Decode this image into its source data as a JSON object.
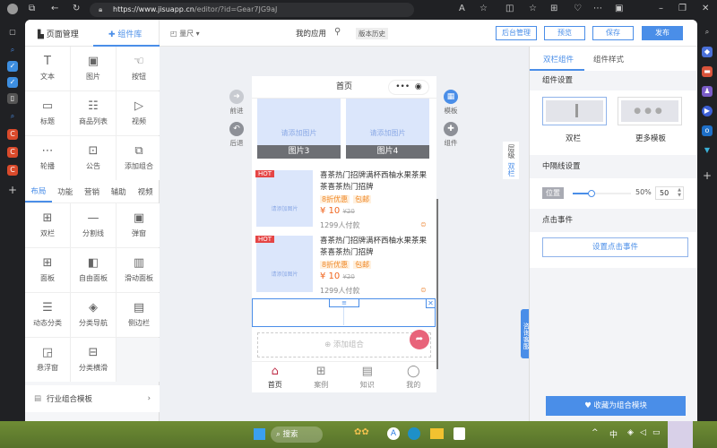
{
  "browser": {
    "url_host": "https://www.jisuapp.cn",
    "url_path": "/editor/?id=Gear7JG9aJ"
  },
  "header": {
    "tab_pages": "页面管理",
    "tab_components": "组件库",
    "ruler": "量尺",
    "app_name": "我的应用",
    "version_history": "版本历史",
    "btn_admin": "后台管理",
    "btn_preview": "预览",
    "btn_save": "保存",
    "btn_publish": "发布"
  },
  "left_panel": {
    "basic": [
      {
        "label": "文本",
        "icon": "T"
      },
      {
        "label": "图片",
        "icon": "▣"
      },
      {
        "label": "按钮",
        "icon": "☜"
      },
      {
        "label": "标题",
        "icon": "▭"
      },
      {
        "label": "商品列表",
        "icon": "☷"
      },
      {
        "label": "视频",
        "icon": "▷"
      },
      {
        "label": "轮播",
        "icon": "⋯"
      },
      {
        "label": "公告",
        "icon": "⊡"
      },
      {
        "label": "添加组合",
        "icon": "⧉"
      }
    ],
    "tabs": [
      "布局",
      "功能",
      "营销",
      "辅助",
      "视频"
    ],
    "layout": [
      {
        "label": "双栏",
        "icon": "⊞"
      },
      {
        "label": "分割线",
        "icon": "—"
      },
      {
        "label": "弹窗",
        "icon": "▣"
      },
      {
        "label": "面板",
        "icon": "⊞"
      },
      {
        "label": "自由面板",
        "icon": "◧"
      },
      {
        "label": "滑动面板",
        "icon": "▥"
      },
      {
        "label": "动态分类",
        "icon": "☰"
      },
      {
        "label": "分类导航",
        "icon": "◈"
      },
      {
        "label": "侧边栏",
        "icon": "▤"
      },
      {
        "label": "悬浮窗",
        "icon": "◲"
      },
      {
        "label": "分类横滑",
        "icon": "⊟"
      }
    ],
    "industry_templates": "行业组合模板"
  },
  "canvas": {
    "forward": "前进",
    "back": "后退",
    "template": "模板",
    "component": "组件",
    "layer": "层级",
    "double": "双栏",
    "consult": "咨询客服"
  },
  "phone": {
    "title": "首页",
    "images": [
      {
        "placeholder": "请添加图片",
        "caption": "图片3"
      },
      {
        "placeholder": "请添加图片",
        "caption": "图片4"
      }
    ],
    "products": [
      {
        "badge": "HOT",
        "placeholder": "请添加图片",
        "title": "喜茶热门招牌满杯西柚水果茶果茶喜茶热门招牌",
        "tag1": "8折优惠",
        "tag2": "包邮",
        "price": "¥ 10",
        "old_price": "¥20",
        "sold": "1299人付款"
      },
      {
        "badge": "HOT",
        "placeholder": "请添加图片",
        "title": "喜茶热门招牌满杯西柚水果茶果茶喜茶热门招牌",
        "tag1": "8折优惠",
        "tag2": "包邮",
        "price": "¥ 10",
        "old_price": "¥20",
        "sold": "1299人付款"
      }
    ],
    "add_combo": "添加组合",
    "nav": [
      "首页",
      "案例",
      "知识",
      "我的"
    ]
  },
  "right_panel": {
    "tab_active": "双栏组件",
    "tab_style": "组件样式",
    "settings": "组件设置",
    "opt1": "双栏",
    "opt2": "更多模板",
    "divider_settings": "中隔线设置",
    "position_label": "位置",
    "position_percent": "50%",
    "position_value": "50",
    "position_fraction": 0.5,
    "click_event": "点击事件",
    "set_click_event": "设置点击事件",
    "save_combo": "收藏为组合模块"
  },
  "taskbar": {
    "search": "搜索",
    "ime": "中"
  },
  "colors": {
    "accent": "#4a8ee8",
    "hot": "#e54545",
    "price": "#f0651e"
  }
}
